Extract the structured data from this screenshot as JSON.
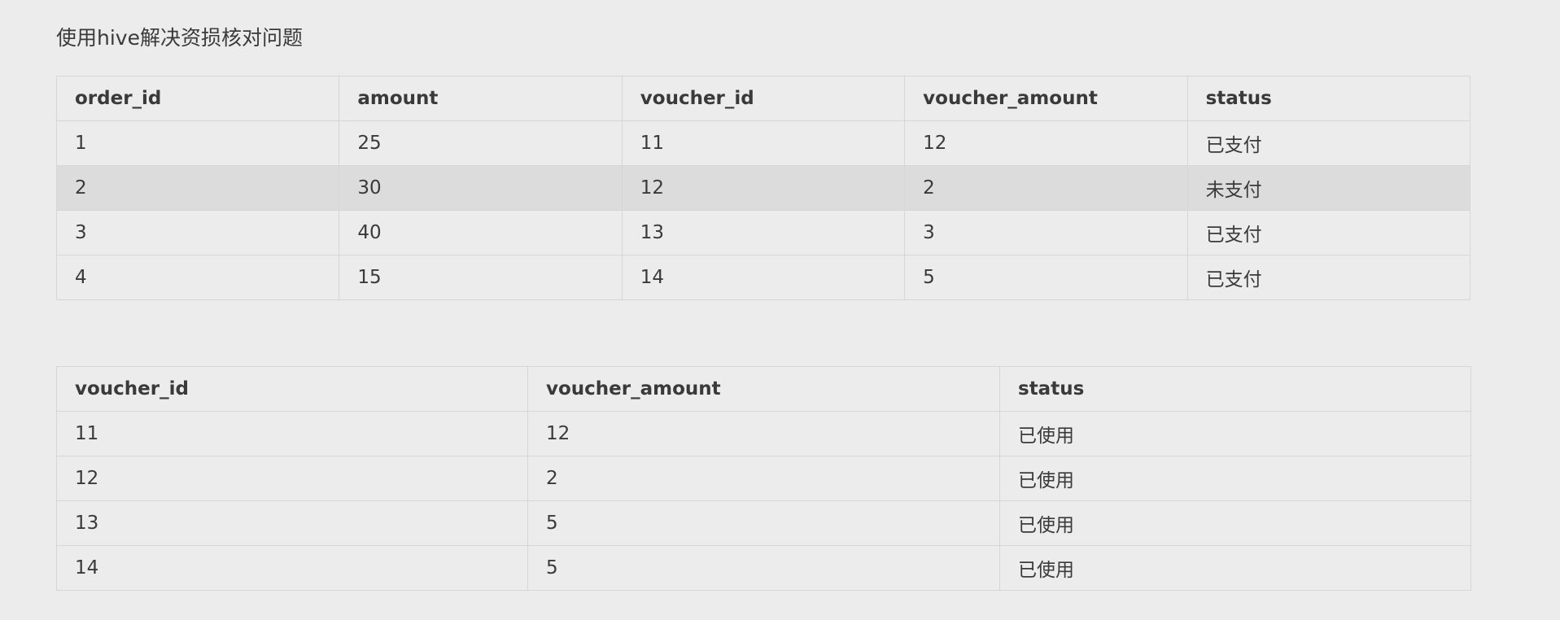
{
  "title": "使用hive解决资损核对问题",
  "orders_table": {
    "columns": [
      "order_id",
      "amount",
      "voucher_id",
      "voucher_amount",
      "status"
    ],
    "rows": [
      [
        "1",
        "25",
        "11",
        "12",
        "已支付"
      ],
      [
        "2",
        "30",
        "12",
        "2",
        "未支付"
      ],
      [
        "3",
        "40",
        "13",
        "3",
        "已支付"
      ],
      [
        "4",
        "15",
        "14",
        "5",
        "已支付"
      ]
    ],
    "highlighted_row": 2
  },
  "vouchers_table": {
    "columns": [
      "voucher_id",
      "voucher_amount",
      "status"
    ],
    "rows": [
      [
        "11",
        "12",
        "已使用"
      ],
      [
        "12",
        "2",
        "已使用"
      ],
      [
        "13",
        "5",
        "已使用"
      ],
      [
        "14",
        "5",
        "已使用"
      ]
    ]
  }
}
